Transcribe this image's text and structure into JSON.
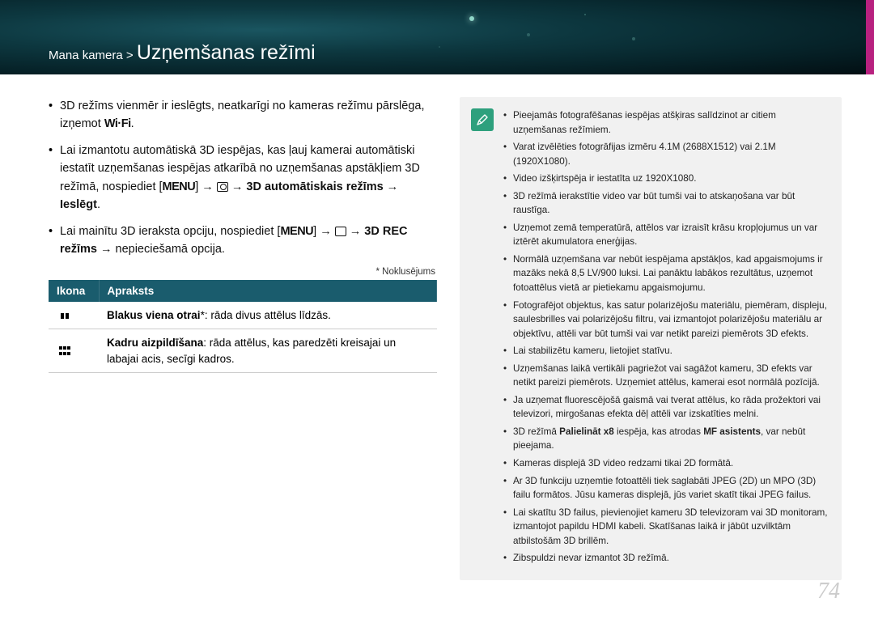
{
  "header": {
    "breadcrumb_prefix": "Mana kamera > ",
    "title": "Uzņemšanas režīmi"
  },
  "left": {
    "bullet1_a": "3D režīms vienmēr ir ieslēgts, neatkarīgi no kameras režīmu pārslēga, izņemot ",
    "bullet1_wifi": "Wi·Fi",
    "bullet1_b": ".",
    "bullet2_a": "Lai izmantotu automātiskā 3D iespējas, kas ļauj kamerai automātiski iestatīt uzņemšanas iespējas atkarībā no uzņemšanas apstākļiem 3D režīmā, nospiediet [",
    "bullet2_menu": "MENU",
    "bullet2_b": "] → ",
    "bullet2_c": " → ",
    "bullet2_bold": "3D automātiskais režīms",
    "bullet2_d": " → ",
    "bullet2_bold2": "Ieslēgt",
    "bullet2_e": ".",
    "bullet3_a": "Lai mainītu 3D ieraksta opciju, nospiediet [",
    "bullet3_menu": "MENU",
    "bullet3_b": "] → ",
    "bullet3_c": " → ",
    "bullet3_bold": "3D REC režīms",
    "bullet3_d": " → nepieciešamā opcija.",
    "default_note": "* Noklusējums",
    "table": {
      "h1": "Ikona",
      "h2": "Apraksts",
      "r1_bold": "Blakus viena otrai",
      "r1_rest": "*: rāda divus attēlus līdzās.",
      "r2_bold": "Kadru aizpildīšana",
      "r2_rest": ": rāda attēlus, kas paredzēti kreisajai un labajai acis, secīgi kadros."
    }
  },
  "notes": {
    "items": [
      "Pieejamās fotografēšanas iespējas atšķiras salīdzinot ar citiem uzņemšanas režīmiem.",
      "Varat izvēlēties fotogrāfijas izmēru 4.1M (2688X1512) vai 2.1M (1920X1080).",
      "Video izšķirtspēja ir iestatīta uz 1920X1080.",
      "3D režīmā ierakstītie video var būt tumši vai to atskaņošana var būt raustīga.",
      "Uzņemot zemā temperatūrā, attēlos var izraisīt krāsu kropļojumus un var iztērēt akumulatora enerģijas.",
      "Normālā uzņemšana var nebūt iespējama apstākļos, kad apgaismojums ir mazāks nekā 8,5 LV/900 luksi. Lai panāktu labākos rezultātus, uzņemot fotoattēlus vietā ar pietiekamu apgaismojumu.",
      "Fotografējot objektus, kas satur polarizējošu materiālu, piemēram, displeju, saulesbrilles vai polarizējošu filtru, vai izmantojot polarizējošu materiālu ar objektīvu, attēli var būt tumši vai var netikt pareizi piemērots 3D efekts.",
      "Lai stabilizētu kameru, lietojiet statīvu.",
      "Uzņemšanas laikā vertikāli pagriežot vai sagāžot kameru, 3D efekts var netikt pareizi piemērots. Uzņemiet attēlus, kamerai esot normālā pozīcijā.",
      "Ja uzņemat fluorescējošā gaismā vai tverat attēlus, ko rāda prožektori vai televizori, mirgošanas efekta dēļ attēli var izskatīties melni.",
      "3D režīmā Palielināt x8 iespēja, kas atrodas MF asistents, var nebūt pieejama.",
      "Kameras displejā 3D video redzami tikai 2D formātā.",
      "Ar 3D funkciju uzņemtie fotoattēli tiek saglabāti JPEG (2D) un MPO (3D) failu formātos. Jūsu kameras displejā, jūs variet skatīt tikai JPEG failus.",
      "Lai skatītu 3D failus, pievienojiet kameru 3D televizoram vai 3D monitoram, izmantojot papildu HDMI kabeli. Skatīšanas laikā ir jābūt uzvilktām atbilstošām 3D brillēm.",
      "Zibspuldzi nevar izmantot 3D režīmā."
    ],
    "bold_10a": "Palielināt x8",
    "bold_10b": "MF asistents"
  },
  "page_num": "74"
}
